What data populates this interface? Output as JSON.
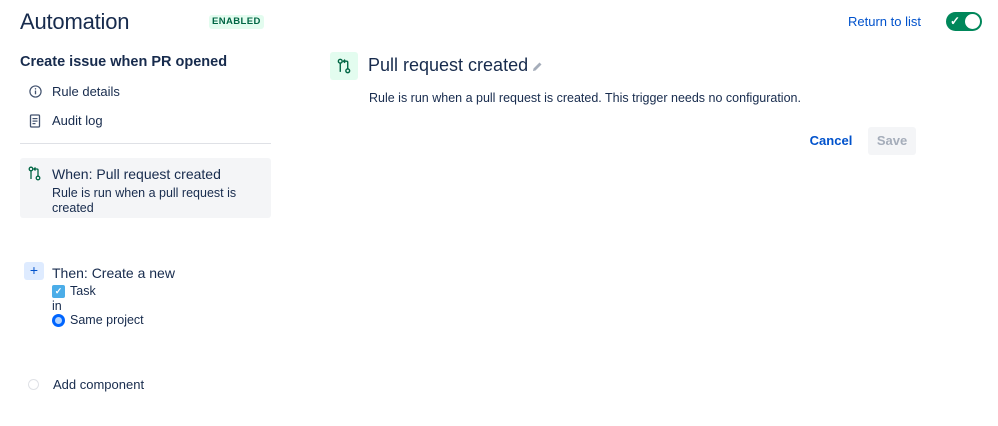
{
  "header": {
    "title": "Automation",
    "status": "ENABLED",
    "return_link": "Return to list",
    "toggle_state": "on",
    "toggle_color": "#00875a"
  },
  "sidebar": {
    "rule_name": "Create issue when PR opened",
    "items": [
      {
        "label": "Rule details",
        "icon": "info-icon"
      },
      {
        "label": "Audit log",
        "icon": "document-icon"
      }
    ],
    "trigger": {
      "title": "When: Pull request created",
      "description": "Rule is run when a pull request is created",
      "icon": "pull-request-icon"
    },
    "action": {
      "title": "Then: Create a new",
      "issue_type": "Task",
      "connector": "in",
      "project": "Same project"
    },
    "add_component": "Add component"
  },
  "detail": {
    "title": "Pull request created",
    "description": "Rule is run when a pull request is created. This trigger needs no configuration.",
    "cancel_label": "Cancel",
    "save_label": "Save",
    "accent_bg": "#e3fcef",
    "accent_fg": "#006644"
  }
}
